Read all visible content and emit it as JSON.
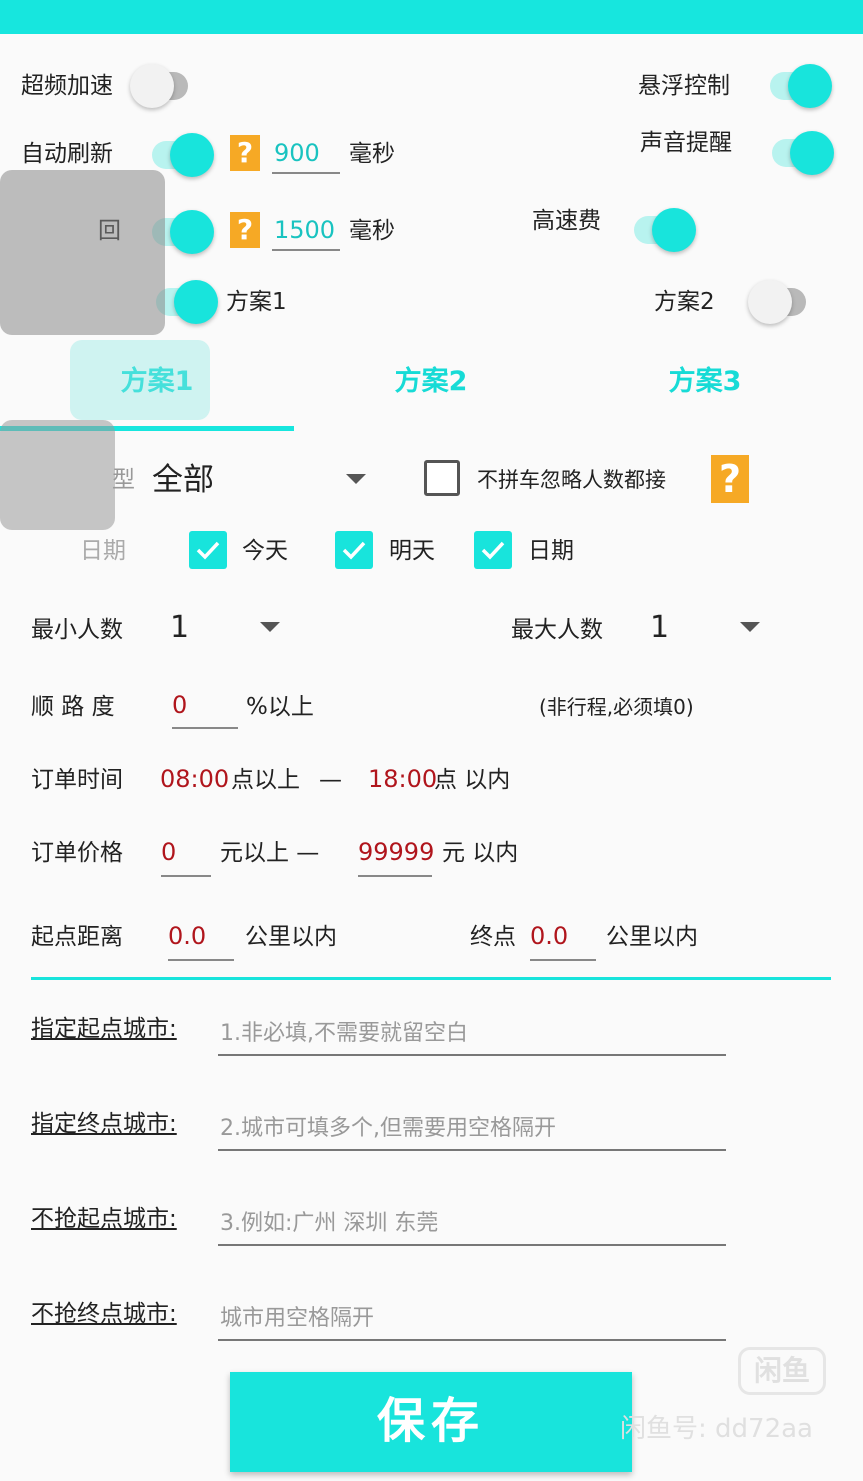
{
  "settings": {
    "overclock_label": "超频加速",
    "float_control_label": "悬浮控制",
    "auto_refresh_label": "自动刷新",
    "auto_refresh_value": "900",
    "auto_refresh_unit": "毫秒",
    "sound_alert_label": "声音提醒",
    "row3_partial_label": "回",
    "row3_value": "1500",
    "row3_unit": "毫秒",
    "highway_fee_label": "高速费",
    "plan1_label": "方案1",
    "plan2_label": "方案2",
    "toggles": {
      "overclock": false,
      "float_control": true,
      "auto_refresh": true,
      "sound_alert": true,
      "row3": true,
      "highway_fee": true,
      "plan1": true,
      "plan2": false
    }
  },
  "tabs": [
    "方案1",
    "方案2",
    "方案3"
  ],
  "filters": {
    "type_partial_label": "型",
    "type_value": "全部",
    "no_carpool_label": "不拼车忽略人数都接",
    "date_partial_label": "日期",
    "today_label": "今天",
    "tomorrow_label": "明天",
    "date_label": "日期",
    "min_people_label": "最小人数",
    "min_people_value": "1",
    "max_people_label": "最大人数",
    "max_people_value": "1",
    "route_label": "顺 路 度",
    "route_value": "0",
    "route_unit": "%以上",
    "route_note": "(非行程,必须填0)",
    "order_time_label": "订单时间",
    "time_start": "08:00",
    "time_start_suffix": "点以上",
    "time_dash": "—",
    "time_end": "18:00",
    "time_end_suffix": "点 以内",
    "order_price_label": "订单价格",
    "price_min": "0",
    "price_min_suffix": "元以上 —",
    "price_max": "99999",
    "price_max_suffix": "元 以内",
    "start_distance_label": "起点距离",
    "start_distance_value": "0.0",
    "start_distance_unit": "公里以内",
    "end_distance_label": "终点",
    "end_distance_value": "0.0",
    "end_distance_unit": "公里以内"
  },
  "cities": [
    {
      "label": "指定起点城市:",
      "placeholder": "1.非必填,不需要就留空白"
    },
    {
      "label": "指定终点城市:",
      "placeholder": "2.城市可填多个,但需要用空格隔开"
    },
    {
      "label": "不抢起点城市:",
      "placeholder": "3.例如:广州 深圳 东莞"
    },
    {
      "label": "不抢终点城市:",
      "placeholder": "城市用空格隔开"
    }
  ],
  "save_label": "保存",
  "watermark": {
    "logo_text": "闲鱼",
    "id_text": "闲鱼号: dd72aa"
  },
  "colors": {
    "accent": "#18e4dc",
    "value_red": "#b0151c",
    "value_teal": "#19c3c0",
    "help_orange": "#f6a925"
  }
}
